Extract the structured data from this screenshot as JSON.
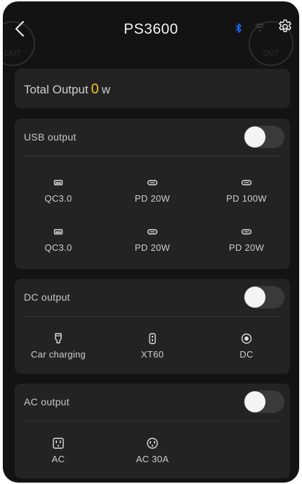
{
  "header": {
    "title": "PS3600",
    "circle_label": "OUT"
  },
  "total": {
    "label": "Total Output",
    "value": "0",
    "unit": "w",
    "value_color": "#f5c518"
  },
  "usb": {
    "title": "USB output",
    "ports": [
      {
        "label": "QC3.0",
        "icon": "usb-a-icon"
      },
      {
        "label": "PD 20W",
        "icon": "usb-c-icon"
      },
      {
        "label": "PD 100W",
        "icon": "usb-c-icon"
      },
      {
        "label": "QC3.0",
        "icon": "usb-a-icon"
      },
      {
        "label": "PD 20W",
        "icon": "usb-c-icon"
      },
      {
        "label": "PD 20W",
        "icon": "usb-c-icon"
      }
    ]
  },
  "dc": {
    "title": "DC output",
    "ports": [
      {
        "label": "Car charging",
        "icon": "car-charger-icon"
      },
      {
        "label": "XT60",
        "icon": "xt60-icon"
      },
      {
        "label": "DC",
        "icon": "dc-port-icon"
      }
    ]
  },
  "ac": {
    "title": "AC output",
    "ports": [
      {
        "label": "AC",
        "icon": "ac-outlet-icon"
      },
      {
        "label": "AC 30A",
        "icon": "ac-30a-outlet-icon"
      }
    ]
  },
  "colors": {
    "background": "#131313",
    "card": "#232323",
    "accent": "#f5c518",
    "bluetooth": "#1e6bff"
  }
}
